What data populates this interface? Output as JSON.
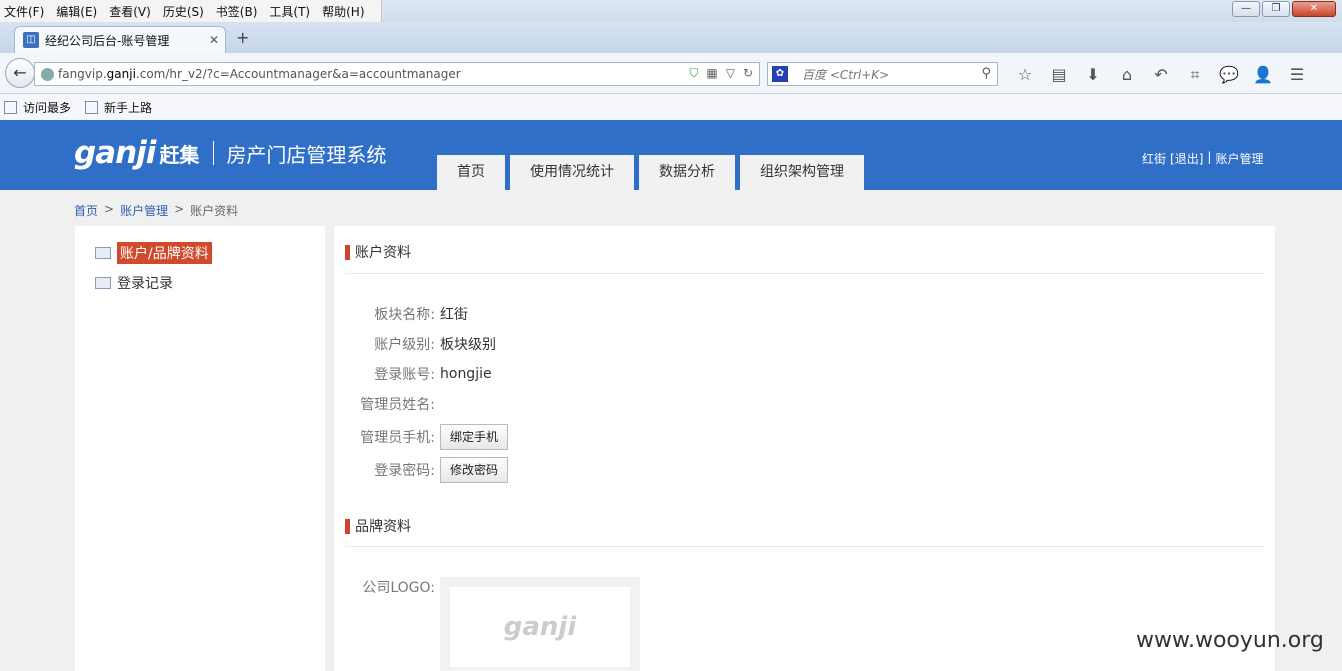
{
  "browser": {
    "menu": [
      "文件(F)",
      "编辑(E)",
      "查看(V)",
      "历史(S)",
      "书签(B)",
      "工具(T)",
      "帮助(H)"
    ],
    "tab_title": "经纪公司后台-账号管理",
    "url_prefix": "fangvip.",
    "url_domain": "ganji",
    "url_rest": ".com/hr_v2/?c=Accountmanager&a=accountmanager",
    "search_placeholder": "百度 <Ctrl+K>",
    "bookmarks": [
      "访问最多",
      "新手上路"
    ]
  },
  "header": {
    "logo_ganji": "ganji",
    "logo_zhao": "赶集",
    "system_name": "房产门店管理系统",
    "nav": [
      "首页",
      "使用情况统计",
      "数据分析",
      "组织架构管理"
    ],
    "user_name": "红街",
    "logout": "[退出]",
    "divider": "|",
    "account_link": "账户管理"
  },
  "breadcrumb": {
    "home": "首页",
    "sep1": ">",
    "account": "账户管理",
    "sep2": ">",
    "current": "账户资料"
  },
  "sidebar": {
    "items": [
      {
        "label": "账户/品牌资料",
        "active": true
      },
      {
        "label": "登录记录",
        "active": false
      }
    ]
  },
  "account_section": {
    "title": "账户资料",
    "board_name_label": "板块名称:",
    "board_name_value": "红街",
    "level_label": "账户级别:",
    "level_value": "板块级别",
    "login_label": "登录账号:",
    "login_value": "hongjie",
    "admin_name_label": "管理员姓名:",
    "admin_name_value": "",
    "phone_label": "管理员手机:",
    "phone_button": "绑定手机",
    "password_label": "登录密码:",
    "password_button": "修改密码"
  },
  "brand_section": {
    "title": "品牌资料",
    "logo_label": "公司LOGO:",
    "logo_placeholder_text": "ganji"
  },
  "watermark": "www.wooyun.org"
}
